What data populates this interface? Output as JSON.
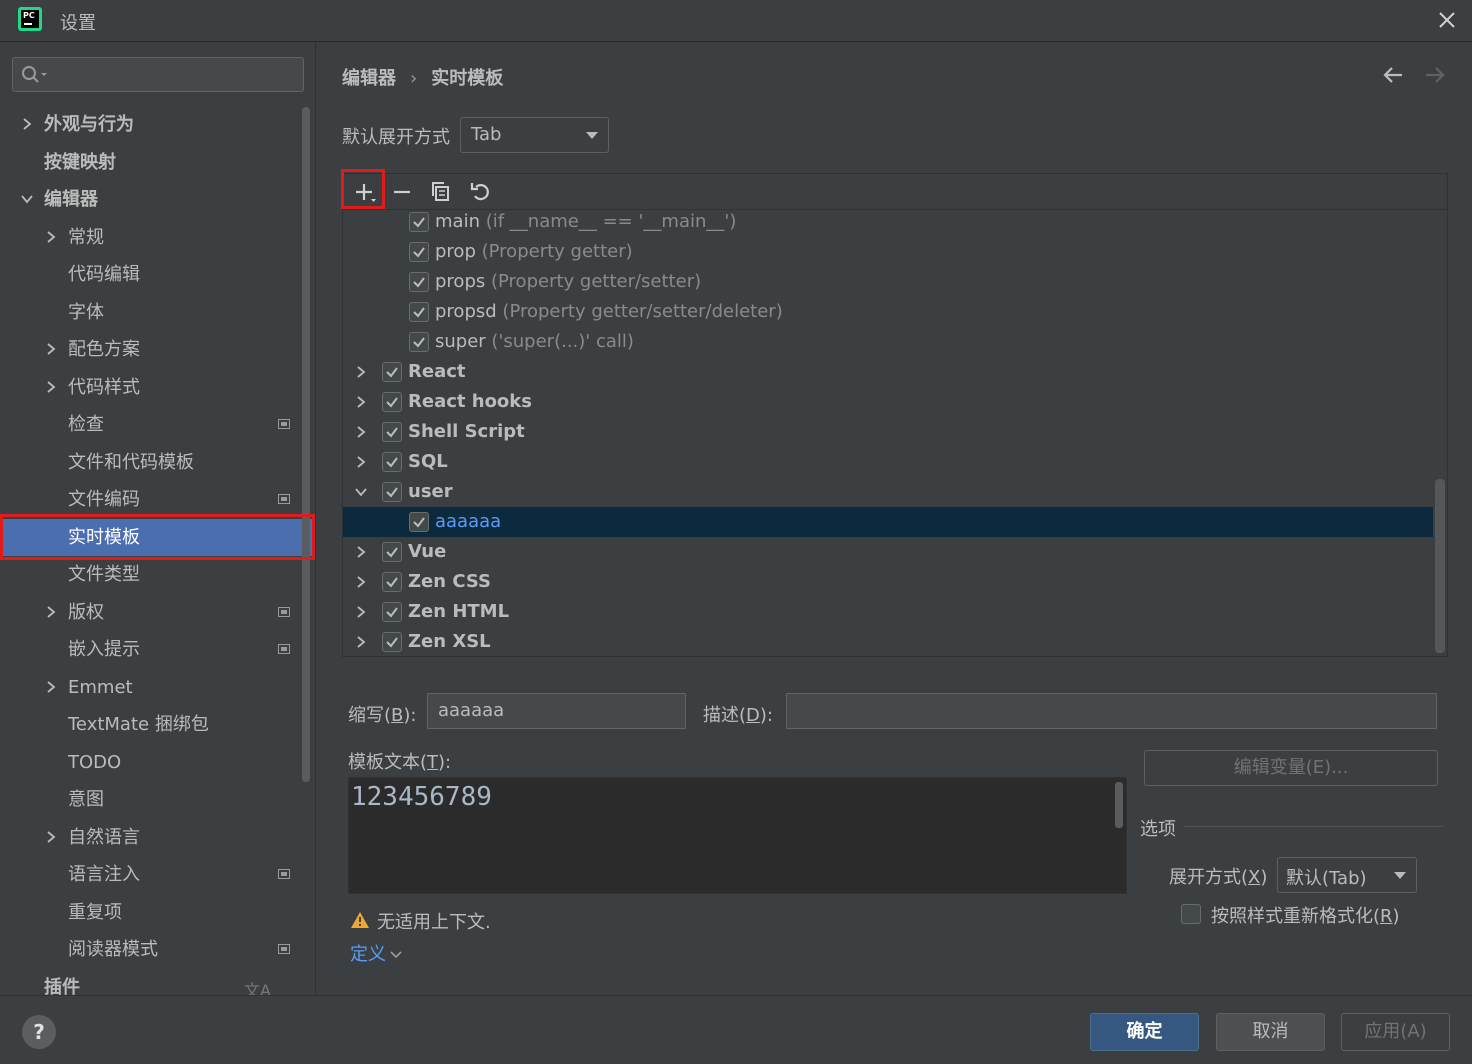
{
  "window": {
    "title": "设置"
  },
  "sidebar": {
    "search_placeholder": "",
    "items": [
      {
        "label": "外观与行为"
      },
      {
        "label": "按键映射"
      },
      {
        "label": "编辑器"
      },
      {
        "label": "常规"
      },
      {
        "label": "代码编辑"
      },
      {
        "label": "字体"
      },
      {
        "label": "配色方案"
      },
      {
        "label": "代码样式"
      },
      {
        "label": "检查"
      },
      {
        "label": "文件和代码模板"
      },
      {
        "label": "文件编码"
      },
      {
        "label": "实时模板"
      },
      {
        "label": "文件类型"
      },
      {
        "label": "版权"
      },
      {
        "label": "嵌入提示"
      },
      {
        "label": "Emmet"
      },
      {
        "label": "TextMate 捆绑包"
      },
      {
        "label": "TODO"
      },
      {
        "label": "意图"
      },
      {
        "label": "自然语言"
      },
      {
        "label": "语言注入"
      },
      {
        "label": "重复项"
      },
      {
        "label": "阅读器模式"
      },
      {
        "label": "插件"
      }
    ]
  },
  "breadcrumb": {
    "parent": "编辑器",
    "current": "实时模板"
  },
  "default_expand": {
    "label": "默认展开方式",
    "value": "Tab"
  },
  "templates": {
    "rows": [
      {
        "name": "main",
        "desc": "(if __name__ == '__main__')"
      },
      {
        "name": "prop",
        "desc": "(Property getter)"
      },
      {
        "name": "props",
        "desc": "(Property getter/setter)"
      },
      {
        "name": "propsd",
        "desc": "(Property getter/setter/deleter)"
      },
      {
        "name": "super",
        "desc": "('super(...)' call)"
      },
      {
        "name": "React",
        "desc": ""
      },
      {
        "name": "React hooks",
        "desc": ""
      },
      {
        "name": "Shell Script",
        "desc": ""
      },
      {
        "name": "SQL",
        "desc": ""
      },
      {
        "name": "user",
        "desc": ""
      },
      {
        "name": "aaaaaa",
        "desc": ""
      },
      {
        "name": "Vue",
        "desc": ""
      },
      {
        "name": "Zen CSS",
        "desc": ""
      },
      {
        "name": "Zen HTML",
        "desc": ""
      },
      {
        "name": "Zen XSL",
        "desc": ""
      }
    ]
  },
  "details": {
    "abbreviation_label_pre": "缩写(",
    "abbreviation_label_key": "B",
    "abbreviation_label_post": "):",
    "abbreviation_value": "aaaaaa",
    "description_label_pre": "描述(",
    "description_label_key": "D",
    "description_label_post": "):",
    "description_value": "",
    "template_text_label_pre": "模板文本(",
    "template_text_label_key": "T",
    "template_text_label_post": "):",
    "template_text": "123456789",
    "edit_variables_button": "编辑变量(E)...",
    "options_label": "选项",
    "expand_with_label_pre": "展开方式(",
    "expand_with_label_key": "X",
    "expand_with_label_post": ")",
    "expand_with_value": "默认(Tab)",
    "reformat_label_pre": "按照样式重新格式化(",
    "reformat_label_key": "R",
    "reformat_label_post": ")",
    "warning_text": "无适用上下文.",
    "define_link": "定义"
  },
  "buttons": {
    "help": "?",
    "ok": "确定",
    "cancel": "取消",
    "apply": "应用(A)"
  },
  "colors": {
    "selection": "#4b6eaf",
    "highlight_box": "#e01b1b",
    "link": "#589df6",
    "checked": "#bbbbbb"
  }
}
